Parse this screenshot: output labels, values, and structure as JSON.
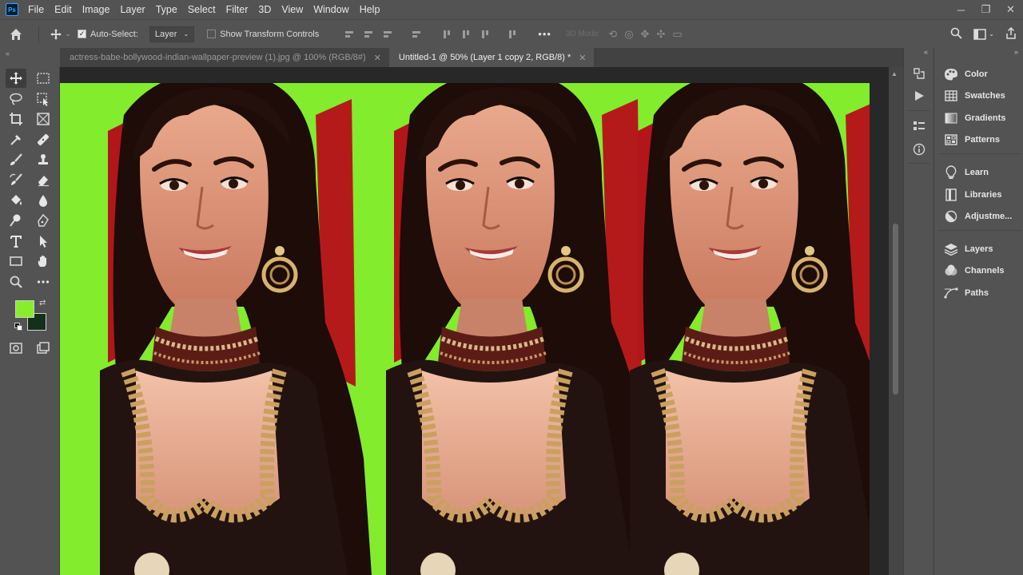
{
  "app": {
    "logo_text": "Ps"
  },
  "menu": [
    "File",
    "Edit",
    "Image",
    "Layer",
    "Type",
    "Select",
    "Filter",
    "3D",
    "View",
    "Window",
    "Help"
  ],
  "window_controls": {
    "minimize": "─",
    "restore": "❐",
    "close": "✕"
  },
  "options_bar": {
    "auto_select_label": "Auto-Select:",
    "auto_select_checked": true,
    "auto_select_target": "Layer",
    "show_transform_label": "Show Transform Controls",
    "show_transform_checked": false,
    "more_label": "•••",
    "mode_3d_label": "3D Mode:"
  },
  "tabs": [
    {
      "label": "actress-babe-bollywood-indian-wallpaper-preview (1).jpg @ 100% (RGB/8#)",
      "active": false
    },
    {
      "label": "Untitled-1 @ 50% (Layer 1 copy 2, RGB/8) *",
      "active": true
    }
  ],
  "colors": {
    "foreground": "#86ee2a",
    "background": "#13301a",
    "canvas_bg": "#83ec2c"
  },
  "panels": [
    {
      "label": "Color",
      "icon": "color-palette-icon"
    },
    {
      "label": "Swatches",
      "icon": "swatches-grid-icon"
    },
    {
      "label": "Gradients",
      "icon": "gradient-icon"
    },
    {
      "label": "Patterns",
      "icon": "patterns-icon"
    },
    {
      "label": "Learn",
      "icon": "lightbulb-icon"
    },
    {
      "label": "Libraries",
      "icon": "libraries-icon"
    },
    {
      "label": "Adjustme...",
      "icon": "adjustments-icon"
    },
    {
      "label": "Layers",
      "icon": "layers-icon"
    },
    {
      "label": "Channels",
      "icon": "channels-icon"
    },
    {
      "label": "Paths",
      "icon": "paths-icon"
    }
  ],
  "canvas_content": {
    "copies": 3
  }
}
